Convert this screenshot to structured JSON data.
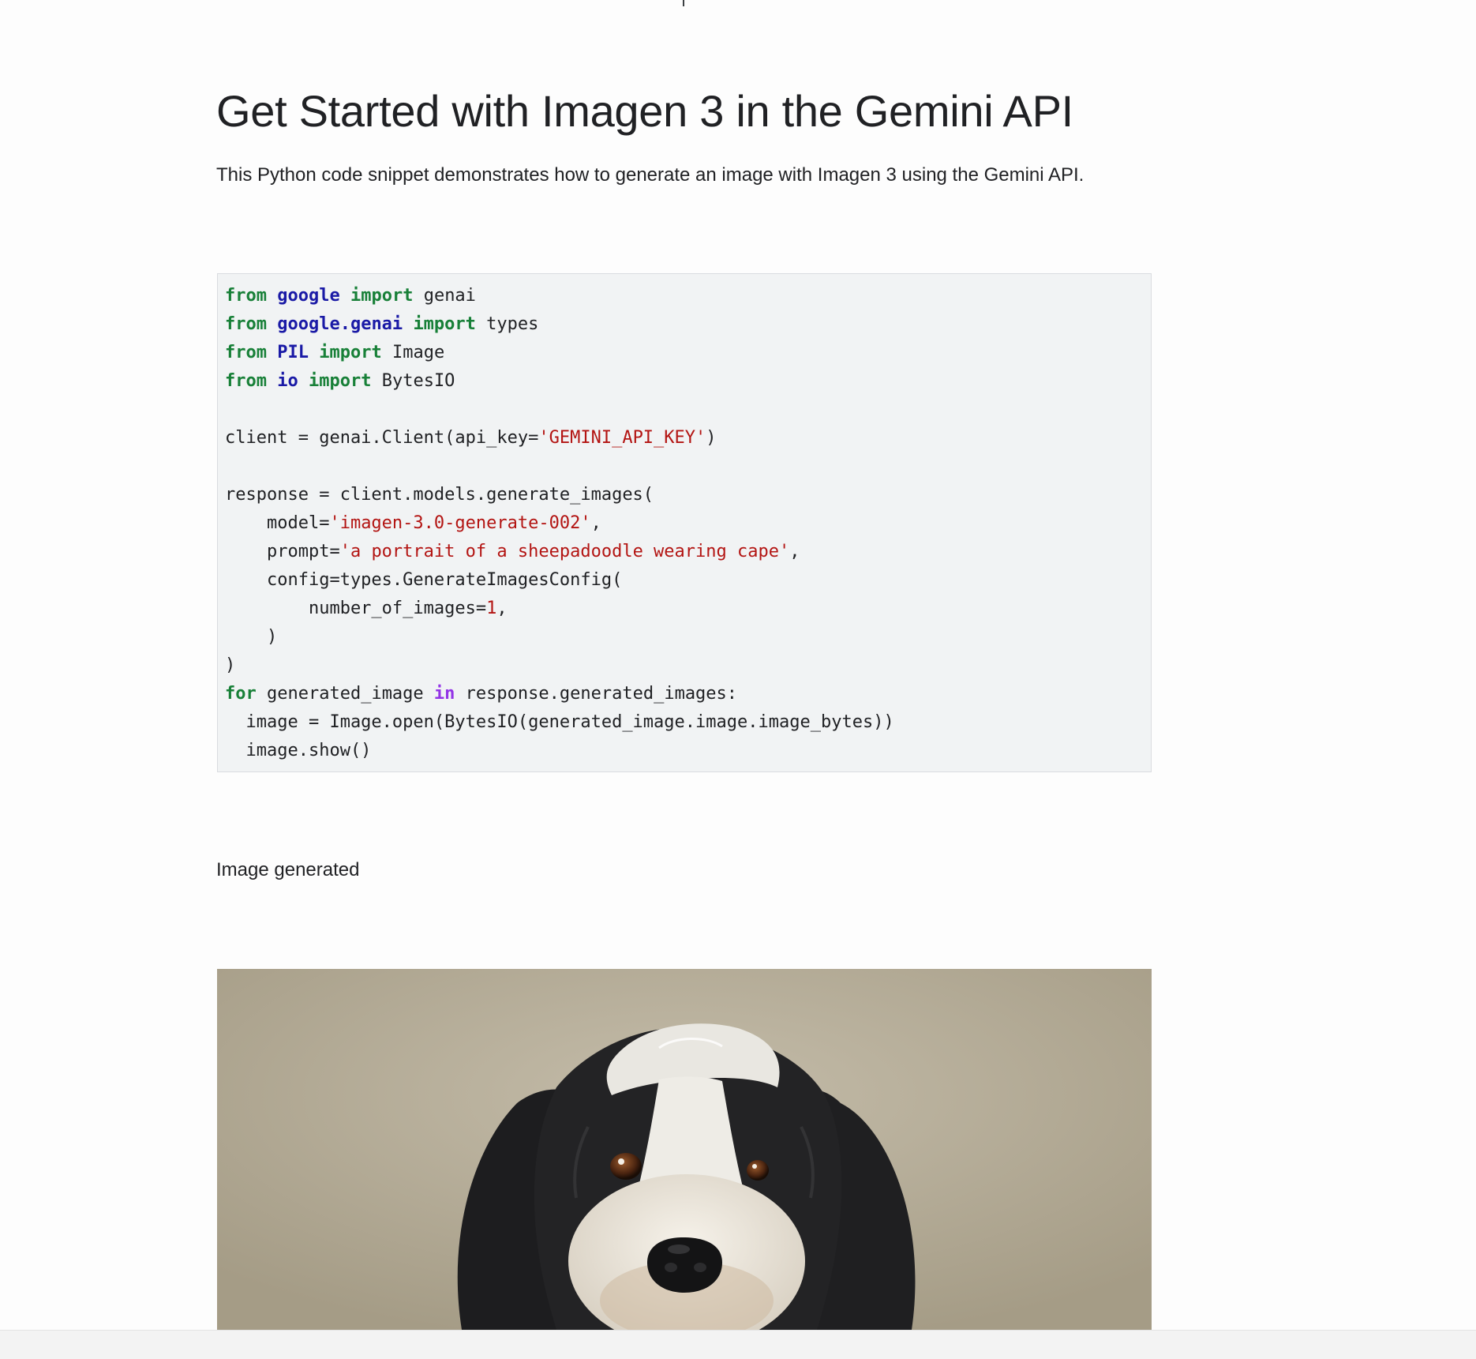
{
  "article": {
    "title": "Get Started with Imagen 3 in the Gemini API",
    "intro": "This Python code snippet demonstrates how to generate an image with Imagen 3 using the Gemini API.",
    "caption": "Image generated"
  },
  "code": {
    "language": "python",
    "lines": [
      [
        {
          "t": "from",
          "c": "kw"
        },
        {
          "t": " "
        },
        {
          "t": "google",
          "c": "mod"
        },
        {
          "t": " "
        },
        {
          "t": "import",
          "c": "kw"
        },
        {
          "t": " genai"
        }
      ],
      [
        {
          "t": "from",
          "c": "kw"
        },
        {
          "t": " "
        },
        {
          "t": "google.genai",
          "c": "mod"
        },
        {
          "t": " "
        },
        {
          "t": "import",
          "c": "kw"
        },
        {
          "t": " types"
        }
      ],
      [
        {
          "t": "from",
          "c": "kw"
        },
        {
          "t": " "
        },
        {
          "t": "PIL",
          "c": "mod"
        },
        {
          "t": " "
        },
        {
          "t": "import",
          "c": "kw"
        },
        {
          "t": " Image"
        }
      ],
      [
        {
          "t": "from",
          "c": "kw"
        },
        {
          "t": " "
        },
        {
          "t": "io",
          "c": "mod"
        },
        {
          "t": " "
        },
        {
          "t": "import",
          "c": "kw"
        },
        {
          "t": " BytesIO"
        }
      ],
      [],
      [
        {
          "t": "client = genai.Client(api_key="
        },
        {
          "t": "'GEMINI_API_KEY'",
          "c": "str"
        },
        {
          "t": ")"
        }
      ],
      [],
      [
        {
          "t": "response = client.models.generate_images("
        }
      ],
      [
        {
          "t": "    model="
        },
        {
          "t": "'imagen-3.0-generate-002'",
          "c": "str"
        },
        {
          "t": ","
        }
      ],
      [
        {
          "t": "    prompt="
        },
        {
          "t": "'a portrait of a sheepadoodle wearing cape'",
          "c": "str"
        },
        {
          "t": ","
        }
      ],
      [
        {
          "t": "    config=types.GenerateImagesConfig("
        }
      ],
      [
        {
          "t": "        number_of_images="
        },
        {
          "t": "1",
          "c": "num"
        },
        {
          "t": ","
        }
      ],
      [
        {
          "t": "    )"
        }
      ],
      [
        {
          "t": ")"
        }
      ],
      [
        {
          "t": "for",
          "c": "kw"
        },
        {
          "t": " generated_image "
        },
        {
          "t": "in",
          "c": "op"
        },
        {
          "t": " response.generated_images:"
        }
      ],
      [
        {
          "t": "  image = Image.open(BytesIO(generated_image.image.image_bytes))"
        }
      ],
      [
        {
          "t": "  image.show()"
        }
      ]
    ]
  },
  "image": {
    "subject": "black-and-white sheepadoodle portrait",
    "background_color": "#b5ad99"
  }
}
